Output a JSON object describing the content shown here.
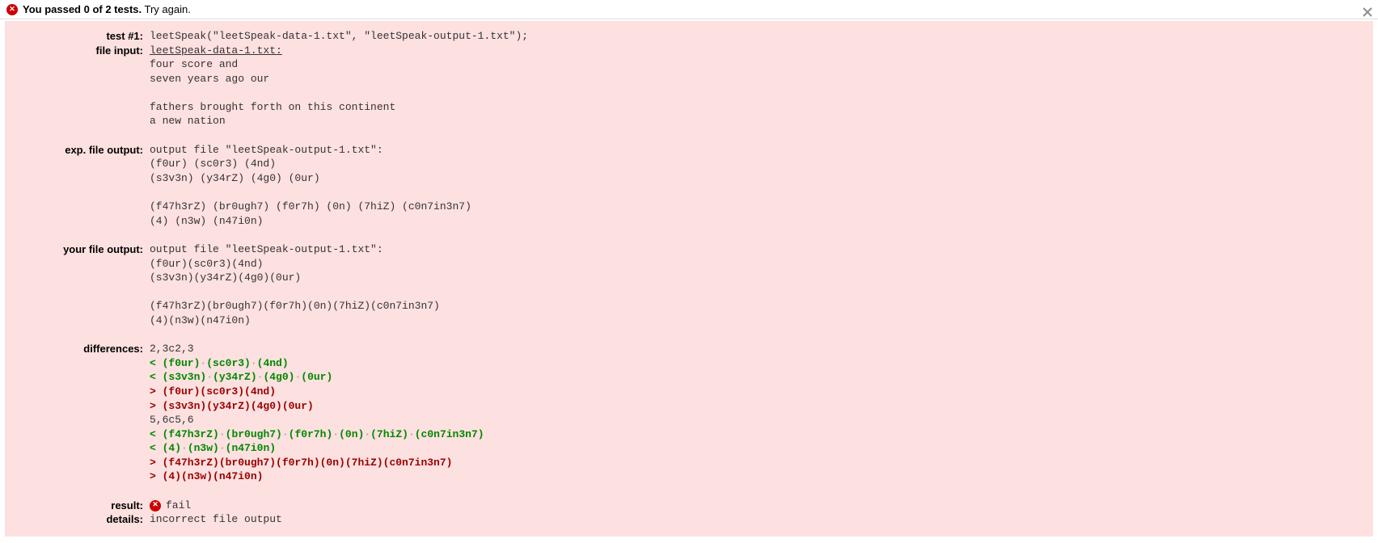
{
  "header": {
    "bold_text": "You passed 0 of 2 tests.",
    "rest_text": " Try again."
  },
  "test": {
    "labels": {
      "test": "test #1:",
      "file_input": "file input:",
      "exp_output": "exp. file output:",
      "your_output": "your file output:",
      "differences": "differences:",
      "result": "result:",
      "details": "details:"
    },
    "call": "leetSpeak(\"leetSpeak-data-1.txt\", \"leetSpeak-output-1.txt\");",
    "file_input_name": "leetSpeak-data-1.txt:",
    "file_input_lines": [
      "four score and",
      "seven years ago our",
      "",
      "fathers brought forth on this continent",
      "a new nation"
    ],
    "exp_output_header": "output file \"leetSpeak-output-1.txt\":",
    "exp_output_lines": [
      "(f0ur) (sc0r3) (4nd)",
      "(s3v3n) (y34rZ) (4g0) (0ur)",
      "",
      "(f47h3rZ) (br0ugh7) (f0r7h) (0n) (7hiZ) (c0n7in3n7)",
      "(4) (n3w) (n47i0n)"
    ],
    "your_output_header": "output file \"leetSpeak-output-1.txt\":",
    "your_output_lines": [
      "(f0ur)(sc0r3)(4nd)",
      "(s3v3n)(y34rZ)(4g0)(0ur)",
      "",
      "(f47h3rZ)(br0ugh7)(f0r7h)(0n)(7hiZ)(c0n7in3n7)",
      "(4)(n3w)(n47i0n)"
    ],
    "diff": [
      {
        "cls": "diff-loc",
        "text": "2,3c2,3"
      },
      {
        "cls": "diff-green",
        "text": "< (f0ur)·(sc0r3)·(4nd)"
      },
      {
        "cls": "diff-green",
        "text": "< (s3v3n)·(y34rZ)·(4g0)·(0ur)"
      },
      {
        "cls": "diff-red",
        "text": "> (f0ur)(sc0r3)(4nd)"
      },
      {
        "cls": "diff-red",
        "text": "> (s3v3n)(y34rZ)(4g0)(0ur)"
      },
      {
        "cls": "diff-loc",
        "text": "5,6c5,6"
      },
      {
        "cls": "diff-green",
        "text": "< (f47h3rZ)·(br0ugh7)·(f0r7h)·(0n)·(7hiZ)·(c0n7in3n7)"
      },
      {
        "cls": "diff-green",
        "text": "< (4)·(n3w)·(n47i0n)"
      },
      {
        "cls": "diff-red",
        "text": "> (f47h3rZ)(br0ugh7)(f0r7h)(0n)(7hiZ)(c0n7in3n7)"
      },
      {
        "cls": "diff-red",
        "text": "> (4)(n3w)(n47i0n)"
      }
    ],
    "result_text": "fail",
    "details_text": "incorrect file output"
  }
}
